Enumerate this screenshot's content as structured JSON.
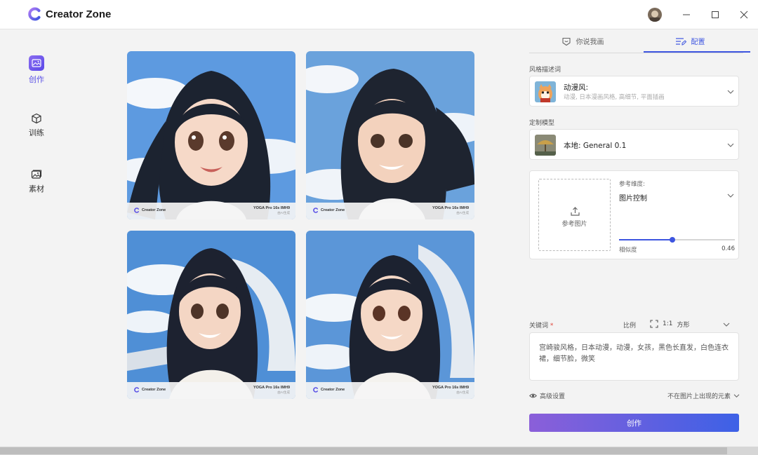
{
  "app": {
    "name": "Creator Zone"
  },
  "nav": [
    {
      "label": "创作",
      "icon": "image-edit-icon",
      "active": true
    },
    {
      "label": "训练",
      "icon": "cube-icon",
      "active": false
    },
    {
      "label": "素材",
      "icon": "gallery-icon",
      "active": false
    }
  ],
  "gallery": {
    "tiles": [
      {
        "brand": "Creator Zone",
        "model": "YOGA Pro 16s IMH9",
        "sub": "由AI生成"
      },
      {
        "brand": "Creator Zone",
        "model": "YOGA Pro 16s IMH9",
        "sub": "由AI生成"
      },
      {
        "brand": "Creator Zone",
        "model": "YOGA Pro 16s IMH9",
        "sub": "由AI生成"
      },
      {
        "brand": "Creator Zone",
        "model": "YOGA Pro 16s IMH9",
        "sub": "由AI生成"
      }
    ]
  },
  "panel": {
    "tabs": [
      {
        "label": "你说我画",
        "icon": "chat-shield-icon",
        "active": false
      },
      {
        "label": "配置",
        "icon": "list-edit-icon",
        "active": true
      }
    ],
    "style": {
      "label": "风格描述词",
      "title": "动漫风:",
      "desc": "动漫, 日本漫画风格, 高细节, 平面插画"
    },
    "model": {
      "label": "定制模型",
      "value": "本地: General 0.1"
    },
    "reference": {
      "upload_label": "参考图片",
      "dimension_label": "参考维度:",
      "dimension_value": "图片控制",
      "similarity_label": "相似度",
      "similarity_value": "0.46",
      "similarity": 0.46
    },
    "keywords": {
      "label": "关键词",
      "required_mark": "*",
      "ratio_label": "比例",
      "ratio_value": "1:1",
      "ratio_name": "方形",
      "text": "宫崎骏风格，日本动漫，动漫，女孩，黑色长直发，白色连衣裙，细节脸，微笑"
    },
    "advanced": {
      "label": "高级设置",
      "negative_label": "不在图片上出现的元素"
    },
    "create_button": "创作"
  },
  "colors": {
    "accent": "#3d55e0",
    "brand_purple": "#5b52e6"
  }
}
